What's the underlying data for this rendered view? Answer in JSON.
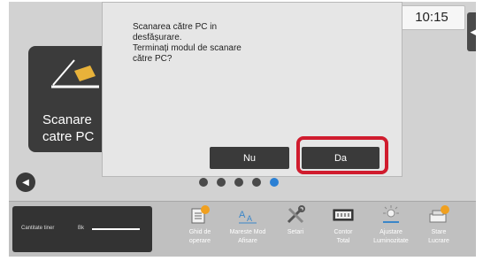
{
  "clock": {
    "time": "10:15"
  },
  "tile": {
    "label_line1": "Scanare",
    "label_line2": "catre PC"
  },
  "dialog": {
    "message_lines": [
      "Scanarea către PC in",
      "desfășurare.",
      "Terminați modul de scanare",
      "către PC?"
    ],
    "no_label": "Nu",
    "yes_label": "Da"
  },
  "counter": {
    "label": "Cantitate tiner",
    "bk": "Bk"
  },
  "toolbar": {
    "items": [
      {
        "line1": "Ghid de",
        "line2": "operare",
        "icon": "manual-icon"
      },
      {
        "line1": "Mareste Mod",
        "line2": "Afisare",
        "icon": "zoom-display-icon"
      },
      {
        "line1": "Setari",
        "line2": "",
        "icon": "settings-tools-icon"
      },
      {
        "line1": "Contor",
        "line2": "Total",
        "icon": "total-counter-icon"
      },
      {
        "line1": "Ajustare",
        "line2": "Luminozitate",
        "icon": "brightness-icon"
      },
      {
        "line1": "Stare",
        "line2": "Lucrare",
        "icon": "job-status-icon"
      }
    ]
  },
  "colors": {
    "highlight": "#d01c2e",
    "active_dot": "#2a7fd4",
    "button_dark": "#3a3a3a"
  },
  "pager": {
    "count": 5,
    "active_index": 4
  }
}
